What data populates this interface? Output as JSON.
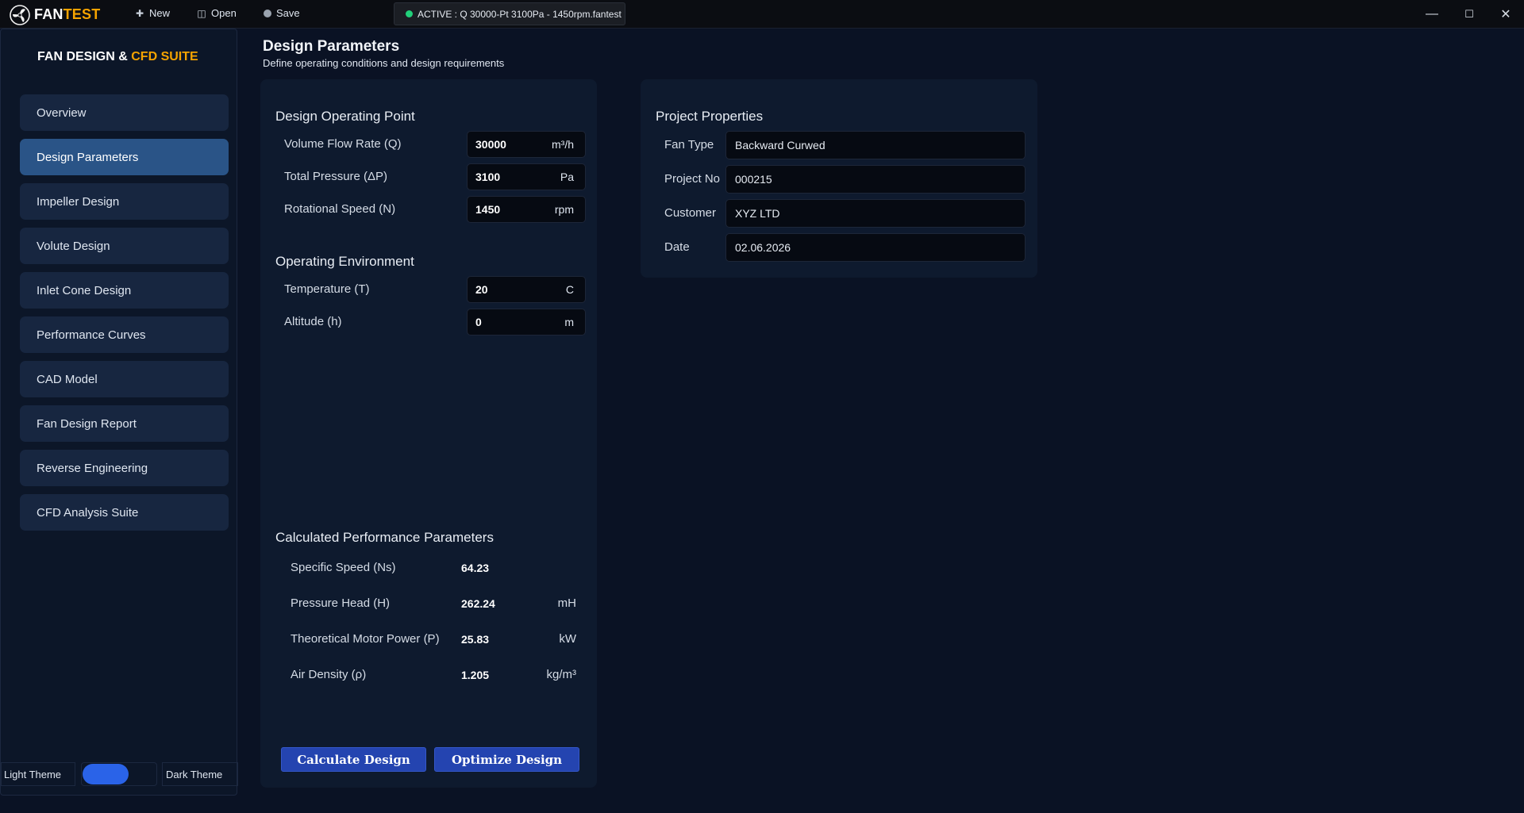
{
  "titlebar": {
    "brand_main": "FAN",
    "brand_accent": "TEST",
    "new_label": "New",
    "open_label": "Open",
    "save_label": "Save",
    "active_file": "ACTIVE : Q 30000-Pt 3100Pa - 1450rpm.fantest",
    "minimize": "—",
    "maximize": "☐",
    "close": "✕"
  },
  "sidebar": {
    "title_main": "FAN DESIGN & ",
    "title_accent": "CFD SUITE",
    "items": [
      {
        "label": "Overview",
        "active": false
      },
      {
        "label": "Design Parameters",
        "active": true
      },
      {
        "label": "Impeller Design",
        "active": false
      },
      {
        "label": "Volute Design",
        "active": false
      },
      {
        "label": "Inlet Cone Design",
        "active": false
      },
      {
        "label": "Performance Curves",
        "active": false
      },
      {
        "label": "CAD Model",
        "active": false
      },
      {
        "label": "Fan Design Report",
        "active": false
      },
      {
        "label": "Reverse Engineering",
        "active": false
      },
      {
        "label": "CFD Analysis Suite",
        "active": false
      }
    ],
    "theme": {
      "light_label": "Light Theme",
      "dark_label": "Dark Theme",
      "selected": "dark"
    }
  },
  "header": {
    "title": "Design Parameters",
    "subtitle": "Define operating conditions and design requirements"
  },
  "operating_point": {
    "title": "Design Operating Point",
    "flow": {
      "label": "Volume Flow Rate (Q)",
      "value": "30000",
      "unit": "m³/h"
    },
    "pressure": {
      "label": "Total Pressure (ΔP)",
      "value": "3100",
      "unit": "Pa"
    },
    "speed": {
      "label": "Rotational Speed (N)",
      "value": "1450",
      "unit": "rpm"
    }
  },
  "environment": {
    "title": "Operating Environment",
    "temperature": {
      "label": "Temperature (T)",
      "value": "20",
      "unit": "C"
    },
    "altitude": {
      "label": "Altitude (h)",
      "value": "0",
      "unit": "m"
    }
  },
  "calculated": {
    "title": "Calculated Performance Parameters",
    "specific_speed": {
      "label": "Specific Speed (Ns)",
      "value": "64.23",
      "unit": ""
    },
    "pressure_head": {
      "label": "Pressure Head (H)",
      "value": "262.24",
      "unit": "mH"
    },
    "motor_power": {
      "label": "Theoretical Motor Power (P)",
      "value": "25.83",
      "unit": "kW"
    },
    "air_density": {
      "label": "Air Density (ρ)",
      "value": "1.205",
      "unit": "kg/m³"
    }
  },
  "actions": {
    "calculate": "Calculate Design",
    "optimize": "Optimize Design"
  },
  "project": {
    "title": "Project Properties",
    "fan_type": {
      "label": "Fan Type",
      "value": "Backward Curwed"
    },
    "project_no": {
      "label": "Project No",
      "value": "000215"
    },
    "customer": {
      "label": "Customer",
      "value": "XYZ LTD"
    },
    "date": {
      "label": "Date",
      "value": "02.06.2026"
    }
  },
  "colors": {
    "background": "#0a1224",
    "panel": "#0e1a2e",
    "accent_orange": "#f5a300",
    "nav_active": "#2a5487",
    "button_blue": "#2444b0",
    "status_green": "#21d07a",
    "toggle_blue": "#2a63e8"
  }
}
